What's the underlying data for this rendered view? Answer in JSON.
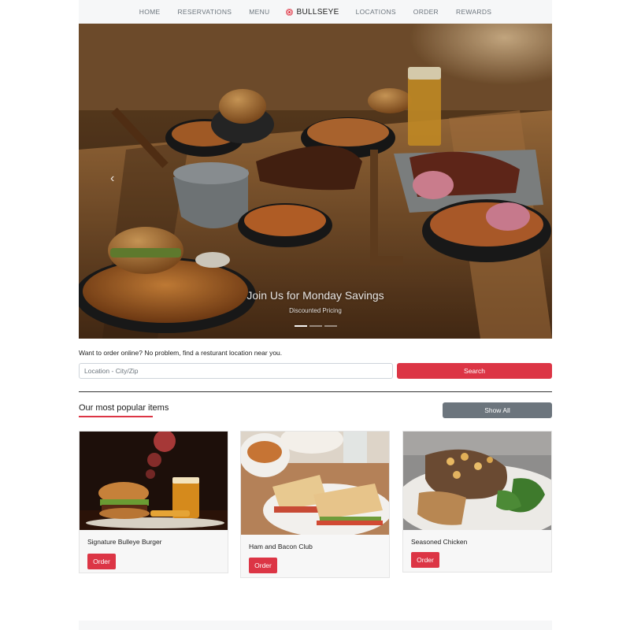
{
  "nav": {
    "items_left": [
      "HOME",
      "RESERVATIONS",
      "MENU"
    ],
    "brand": "BULLSEYE",
    "items_right": [
      "LOCATIONS",
      "ORDER",
      "REWARDS"
    ]
  },
  "hero": {
    "title": "Join Us for Monday Savings",
    "subtitle": "Discounted Pricing",
    "prev_icon": "chevron-left-icon",
    "slide_count": 3,
    "active_slide": 1
  },
  "search": {
    "prompt": "Want to order online? No problem, find a resturant location near you.",
    "placeholder": "Location - City/Zip",
    "value": "",
    "button": "Search"
  },
  "popular": {
    "title": "Our most popular items",
    "show_all": "Show All",
    "items": [
      {
        "name": "Signature Bulleye Burger",
        "button": "Order"
      },
      {
        "name": "Ham and Bacon Club",
        "button": "Order"
      },
      {
        "name": "Seasoned Chicken",
        "button": "Order"
      }
    ]
  },
  "colors": {
    "accent": "#dc3545",
    "secondary": "#6c757d",
    "nav_bg": "#f6f7f8"
  }
}
